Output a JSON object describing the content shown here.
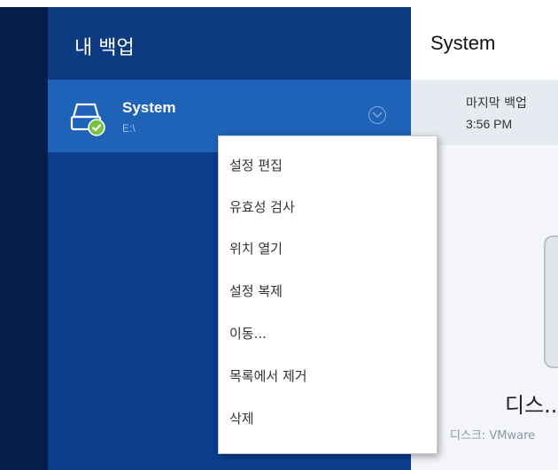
{
  "panel": {
    "title": "내 백업"
  },
  "backup_item": {
    "name": "System",
    "path": "E:\\"
  },
  "right": {
    "title": "System",
    "last_backup_label": "마지막 백업",
    "last_backup_time": "3:56 PM",
    "disk_name": "디스...",
    "disk_desc": "디스크: VMware"
  },
  "menu": {
    "items": [
      {
        "label": "설정 편집"
      },
      {
        "label": "유효성 검사"
      },
      {
        "label": "위치 열기"
      },
      {
        "label": "설정 복제"
      },
      {
        "label": "이동..."
      },
      {
        "label": "목록에서 제거"
      },
      {
        "label": "삭제"
      }
    ]
  },
  "colors": {
    "rail": "#041e4a",
    "panel": "#0b3f8e",
    "selected": "#1f63b8",
    "status_ok": "#7ac143"
  }
}
